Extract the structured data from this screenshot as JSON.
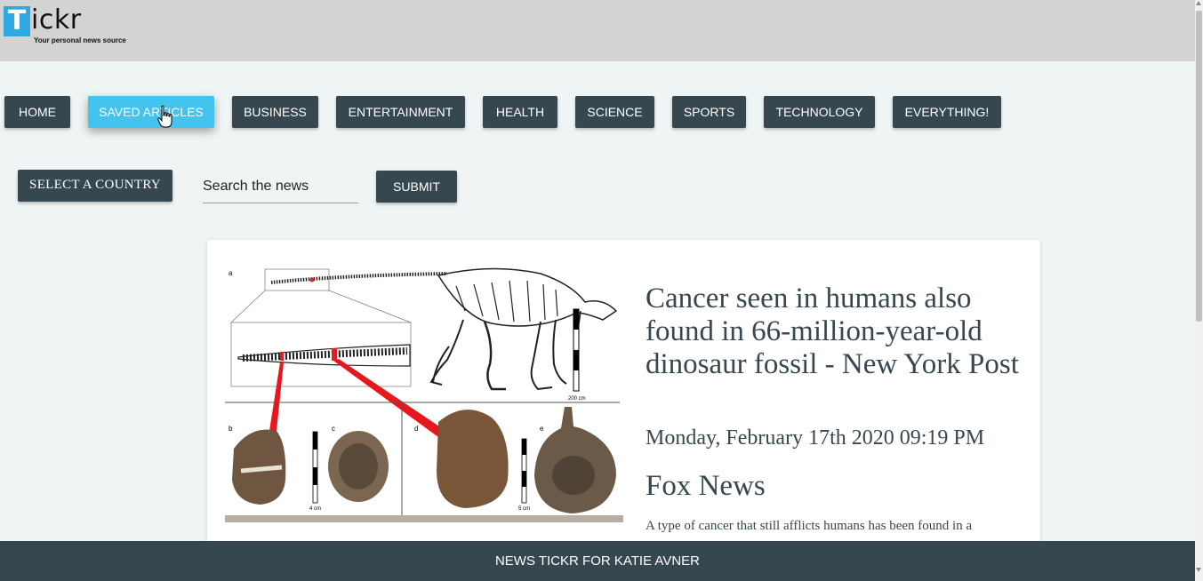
{
  "logo": {
    "letter": "T",
    "rest": "ickr",
    "tagline": "Your personal news source"
  },
  "nav": {
    "items": [
      {
        "label": "HOME",
        "active": false
      },
      {
        "label": "SAVED ARTICLES",
        "active": true
      },
      {
        "label": "BUSINESS",
        "active": false
      },
      {
        "label": "ENTERTAINMENT",
        "active": false
      },
      {
        "label": "HEALTH",
        "active": false
      },
      {
        "label": "SCIENCE",
        "active": false
      },
      {
        "label": "SPORTS",
        "active": false
      },
      {
        "label": "TECHNOLOGY",
        "active": false
      },
      {
        "label": "EVERYTHING!",
        "active": false
      }
    ]
  },
  "search": {
    "country_label": "SELECT A COUNTRY",
    "placeholder": "Search the news",
    "submit_label": "SUBMIT"
  },
  "article": {
    "title": "Cancer seen in humans also found in 66-million-year-old dinosaur fossil - New York Post",
    "date": "Monday, February 17th 2020 09:19 PM",
    "source": "Fox News",
    "snippet": "A type of cancer that still afflicts humans has been found in a",
    "image_labels": {
      "panel_a": "a",
      "panel_b": "b",
      "panel_c": "c",
      "panel_d": "d",
      "panel_e": "e",
      "scale_a": "200 cm",
      "scale_b": "4 cm",
      "scale_d": "5 cm"
    }
  },
  "footer": {
    "text": "NEWS TICKR FOR KATIE AVNER"
  },
  "colors": {
    "header": "#d3d3d3",
    "button": "#37474f",
    "active_button": "#45c3ef",
    "background": "#eff4f4",
    "logo_accent": "#2fa8e0"
  }
}
